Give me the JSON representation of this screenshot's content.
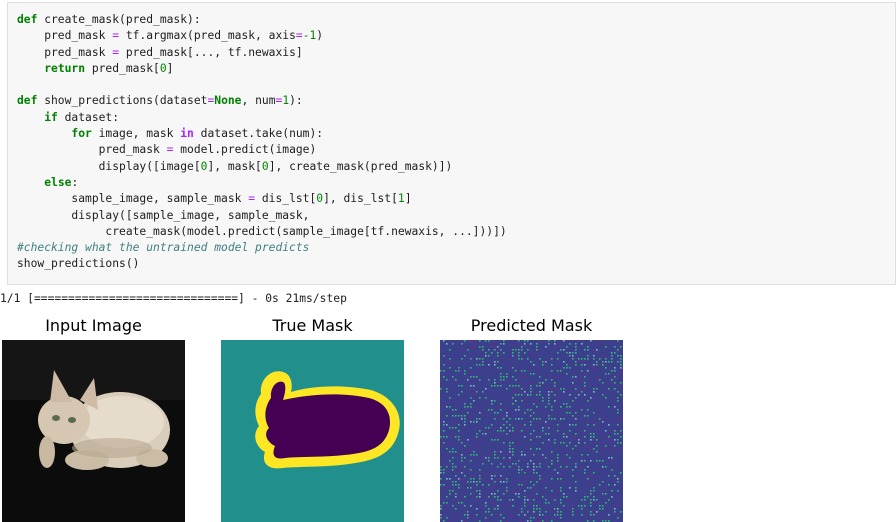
{
  "code_lines": [
    {
      "tokens": [
        [
          "kw",
          "def"
        ],
        [
          "t",
          " create_mask(pred_mask):"
        ]
      ]
    },
    {
      "tokens": [
        [
          "t",
          "    pred_mask "
        ],
        [
          "op",
          "="
        ],
        [
          "t",
          " tf.argmax(pred_mask, axis"
        ],
        [
          "op",
          "="
        ],
        [
          "num",
          "-1"
        ],
        [
          "t",
          ")"
        ]
      ]
    },
    {
      "tokens": [
        [
          "t",
          "    pred_mask "
        ],
        [
          "op",
          "="
        ],
        [
          "t",
          " pred_mask[..., tf.newaxis]"
        ]
      ]
    },
    {
      "tokens": [
        [
          "t",
          "    "
        ],
        [
          "kw",
          "return"
        ],
        [
          "t",
          " pred_mask["
        ],
        [
          "num",
          "0"
        ],
        [
          "t",
          "]"
        ]
      ]
    },
    {
      "tokens": [
        [
          "t",
          ""
        ]
      ]
    },
    {
      "tokens": [
        [
          "kw",
          "def"
        ],
        [
          "t",
          " show_predictions(dataset"
        ],
        [
          "op",
          "="
        ],
        [
          "const",
          "None"
        ],
        [
          "t",
          ", num"
        ],
        [
          "op",
          "="
        ],
        [
          "num",
          "1"
        ],
        [
          "t",
          "):"
        ]
      ]
    },
    {
      "tokens": [
        [
          "t",
          "    "
        ],
        [
          "kw",
          "if"
        ],
        [
          "t",
          " dataset:"
        ]
      ]
    },
    {
      "tokens": [
        [
          "t",
          "        "
        ],
        [
          "kw",
          "for"
        ],
        [
          "t",
          " image, mask "
        ],
        [
          "kw2",
          "in"
        ],
        [
          "t",
          " dataset.take(num):"
        ]
      ]
    },
    {
      "tokens": [
        [
          "t",
          "            pred_mask "
        ],
        [
          "op",
          "="
        ],
        [
          "t",
          " model.predict(image)"
        ]
      ]
    },
    {
      "tokens": [
        [
          "t",
          "            display([image["
        ],
        [
          "num",
          "0"
        ],
        [
          "t",
          "], mask["
        ],
        [
          "num",
          "0"
        ],
        [
          "t",
          "], create_mask(pred_mask)])"
        ]
      ]
    },
    {
      "tokens": [
        [
          "t",
          "    "
        ],
        [
          "kw",
          "else"
        ],
        [
          "t",
          ":"
        ]
      ]
    },
    {
      "tokens": [
        [
          "t",
          "        sample_image, sample_mask "
        ],
        [
          "op",
          "="
        ],
        [
          "t",
          " dis_lst["
        ],
        [
          "num",
          "0"
        ],
        [
          "t",
          "], dis_lst["
        ],
        [
          "num",
          "1"
        ],
        [
          "t",
          "]"
        ]
      ]
    },
    {
      "tokens": [
        [
          "t",
          "        display([sample_image, sample_mask,"
        ]
      ]
    },
    {
      "tokens": [
        [
          "t",
          "             create_mask(model.predict(sample_image[tf.newaxis, ...]))])"
        ]
      ]
    },
    {
      "tokens": [
        [
          "cm",
          "#checking what the untrained model predicts"
        ]
      ]
    },
    {
      "tokens": [
        [
          "t",
          "show_predictions()"
        ]
      ]
    }
  ],
  "output": {
    "progress_text": "1/1 [==============================] - 0s 21ms/step"
  },
  "panels": [
    {
      "title": "Input Image"
    },
    {
      "title": "True Mask"
    },
    {
      "title": "Predicted Mask"
    }
  ],
  "colors": {
    "mask_background": "#21908d",
    "mask_foreground": "#440154",
    "mask_border": "#fde725",
    "pred_background": "#3b3f8c",
    "pred_noise": "#35b779"
  }
}
